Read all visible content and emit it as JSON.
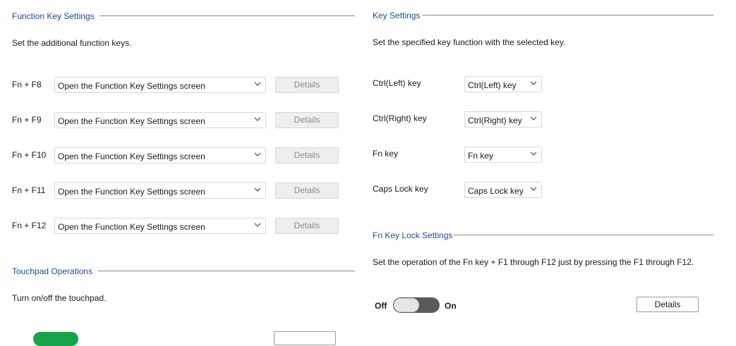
{
  "function_key_settings": {
    "title": "Function Key Settings",
    "description": "Set the additional function keys.",
    "details_label": "Details",
    "rows": [
      {
        "key": "Fn + F8",
        "value": "Open the Function Key Settings screen"
      },
      {
        "key": "Fn + F9",
        "value": "Open the Function Key Settings screen"
      },
      {
        "key": "Fn + F10",
        "value": "Open the Function Key Settings screen"
      },
      {
        "key": "Fn + F11",
        "value": "Open the Function Key Settings screen"
      },
      {
        "key": "Fn + F12",
        "value": "Open the Function Key Settings screen"
      }
    ]
  },
  "touchpad": {
    "title": "Touchpad Operations",
    "description": "Turn on/off the touchpad.",
    "toggle_on": true
  },
  "key_settings": {
    "title": "Key Settings",
    "description": "Set the specified key function with the selected key.",
    "rows": [
      {
        "key": "Ctrl(Left) key",
        "value": "Ctrl(Left) key"
      },
      {
        "key": "Ctrl(Right) key",
        "value": "Ctrl(Right) key"
      },
      {
        "key": "Fn key",
        "value": "Fn key"
      },
      {
        "key": "Caps Lock key",
        "value": "Caps Lock key"
      }
    ]
  },
  "fn_key_lock": {
    "title": "Fn Key Lock Settings",
    "description": "Set the operation of the Fn key + F1 through F12 just by pressing the F1 through F12.",
    "off_label": "Off",
    "on_label": "On",
    "toggle_on": false,
    "details_label": "Details"
  },
  "colors": {
    "section_title": "#1f4aa0",
    "toggle_on": "#16a34a",
    "toggle_off": "#5a5a5a"
  }
}
